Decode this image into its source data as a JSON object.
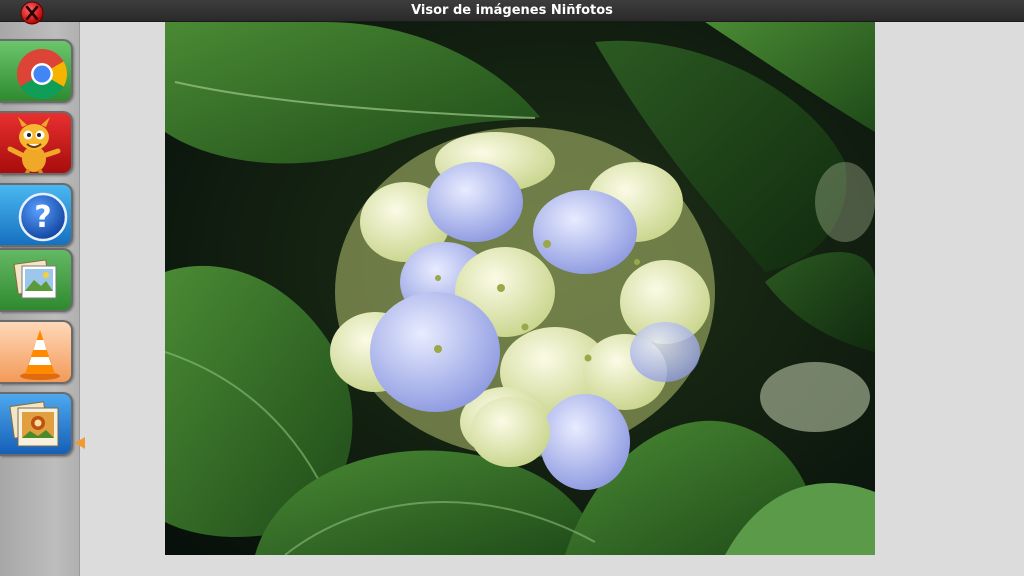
{
  "window": {
    "title": "Visor de imágenes Niñfotos",
    "close_icon": "close-x-icon"
  },
  "dock": {
    "items": [
      {
        "id": "chrome",
        "icon": "chrome-icon",
        "color": "#3a9a3a"
      },
      {
        "id": "dragon-game",
        "icon": "dragon-mascot-icon",
        "color": "#c91414"
      },
      {
        "id": "help",
        "icon": "help-question-icon",
        "color": "#1f8fd8"
      },
      {
        "id": "photos-1",
        "icon": "photos-stack-icon",
        "color": "#3c9a3c"
      },
      {
        "id": "vlc",
        "icon": "vlc-cone-icon",
        "color": "#f08a3a"
      },
      {
        "id": "photos-active",
        "icon": "photos-stack-icon",
        "color": "#1f7fd6"
      }
    ],
    "active_item": "photos-active",
    "indicator_color": "#f09a30"
  },
  "viewer": {
    "image_subject": "hydrangea-flower-photo"
  }
}
